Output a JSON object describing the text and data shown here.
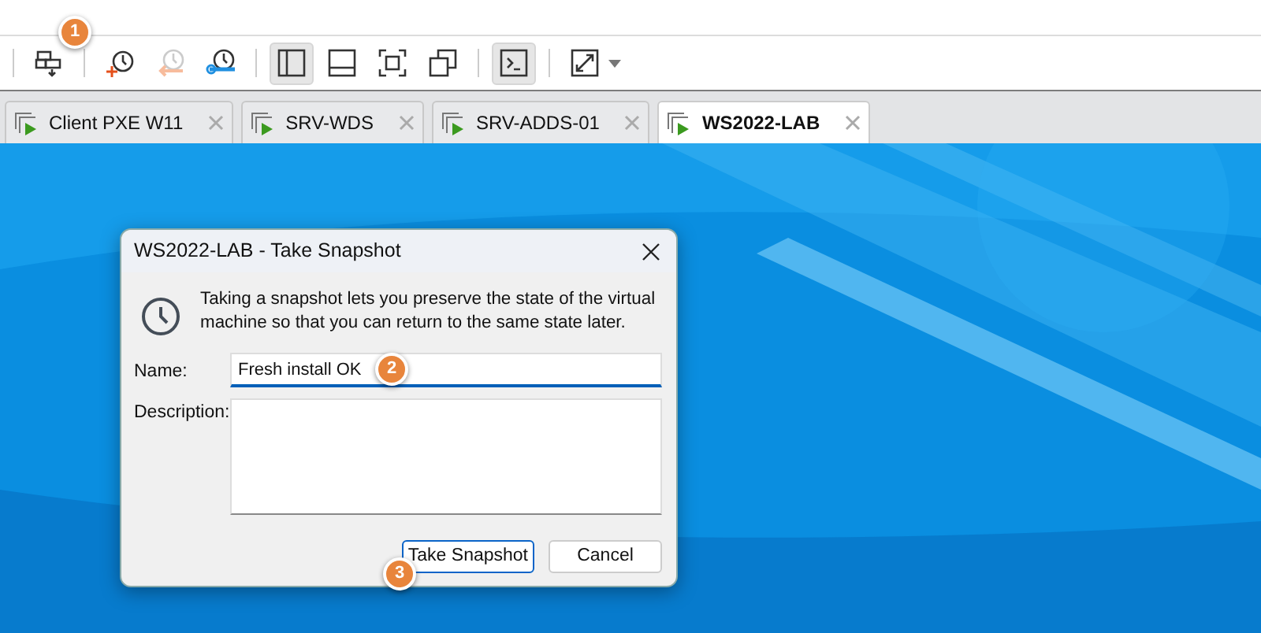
{
  "toolbar": {
    "groups": [
      {
        "items": [
          {
            "pressed": false,
            "disabled": false
          }
        ]
      },
      {
        "items": [
          {
            "pressed": false,
            "disabled": false
          },
          {
            "pressed": false,
            "disabled": true
          },
          {
            "pressed": false,
            "disabled": false
          }
        ]
      },
      {
        "items": [
          {
            "pressed": true,
            "disabled": false
          },
          {
            "pressed": false,
            "disabled": false
          },
          {
            "pressed": false,
            "disabled": false
          },
          {
            "pressed": false,
            "disabled": false
          }
        ]
      },
      {
        "items": [
          {
            "pressed": true,
            "disabled": false
          }
        ]
      },
      {
        "items": [
          {
            "pressed": false,
            "disabled": false
          }
        ]
      }
    ]
  },
  "tabs": [
    {
      "label": "Client PXE W11",
      "selected": false
    },
    {
      "label": "SRV-WDS",
      "selected": false
    },
    {
      "label": "SRV-ADDS-01",
      "selected": false
    },
    {
      "label": "WS2022-LAB",
      "selected": true
    }
  ],
  "dialog": {
    "title": "WS2022-LAB - Take Snapshot",
    "message": "Taking a snapshot lets you preserve the state of the virtual machine so that you can return to the same state later.",
    "name_label": "Name:",
    "name_value": "Fresh install OK",
    "description_label": "Description:",
    "buttons": [
      {
        "label": "Take Snapshot",
        "default": true
      },
      {
        "label": "Cancel",
        "default": false
      }
    ]
  },
  "callouts": [
    {
      "label": "1"
    },
    {
      "label": "2"
    },
    {
      "label": "3"
    }
  ]
}
